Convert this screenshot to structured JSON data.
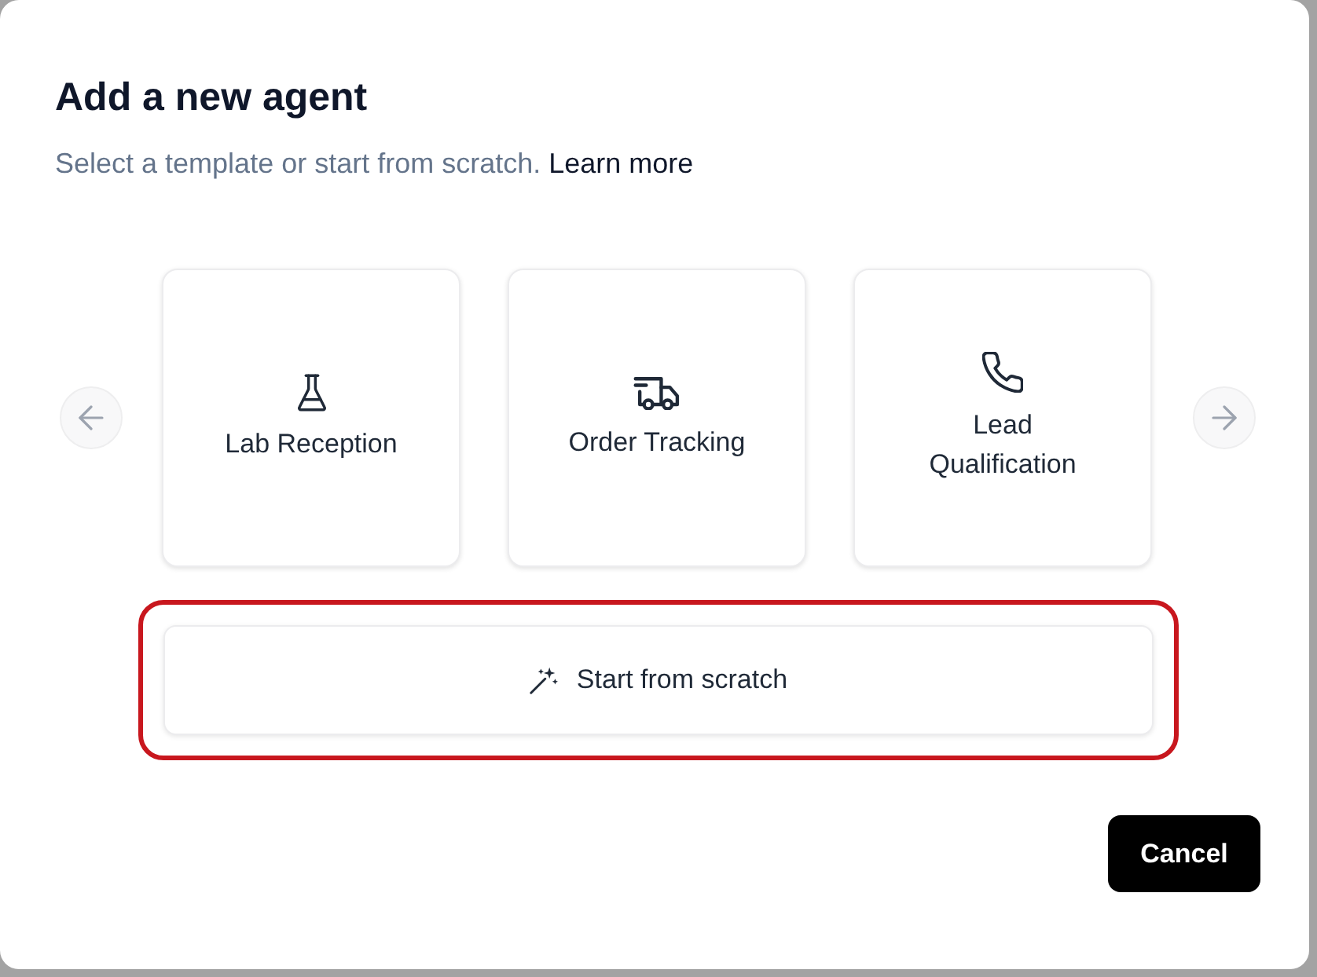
{
  "dialog": {
    "title": "Add a new agent",
    "subtitle": "Select a template or start from scratch.",
    "learn_more_link": "Learn more"
  },
  "templates": [
    {
      "label": "Lab Reception"
    },
    {
      "label": "Order Tracking"
    },
    {
      "label": "Lead Qualification"
    }
  ],
  "start_button": {
    "label": "Start from scratch",
    "highlighted": true
  },
  "cancel_button": {
    "label": "Cancel"
  }
}
